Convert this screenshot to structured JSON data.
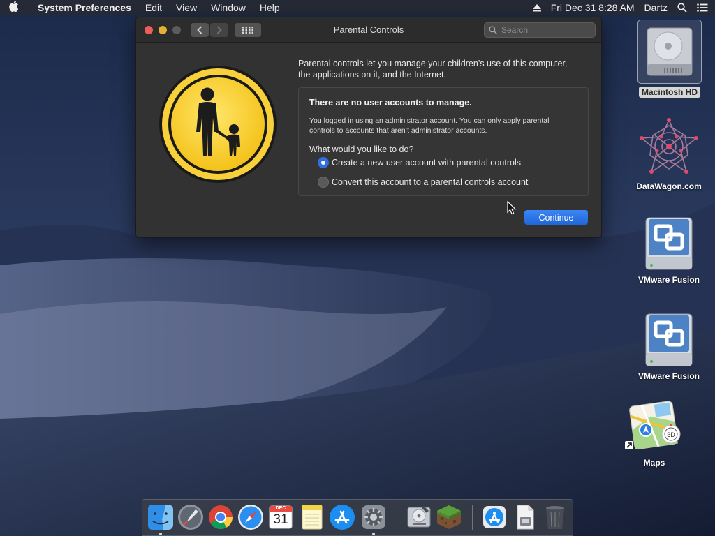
{
  "menubar": {
    "app_name": "System Preferences",
    "menus": [
      "Edit",
      "View",
      "Window",
      "Help"
    ],
    "clock": "Fri Dec 31  8:28 AM",
    "user": "Dartz"
  },
  "window": {
    "title": "Parental Controls",
    "search_placeholder": "Search",
    "intro": "Parental controls let you manage your children’s use of this computer, the applications on it, and the Internet.",
    "panel": {
      "heading": "There are no user accounts to manage.",
      "note": "You logged in using an administrator account. You can only apply parental controls to accounts that aren’t administrator accounts.",
      "question": "What would you like to do?",
      "options": [
        {
          "label": "Create a new user account with parental controls",
          "selected": true
        },
        {
          "label": "Convert this account to a parental controls account",
          "selected": false
        }
      ]
    },
    "continue_label": "Continue"
  },
  "desktop": {
    "icons": [
      {
        "label": "Macintosh HD",
        "icon": "hard-drive-icon",
        "selected": true
      },
      {
        "label": "DataWagon.com",
        "icon": "datawagon-icon"
      },
      {
        "label": "VMware Fusion",
        "icon": "vmware-fusion-icon"
      },
      {
        "label": "VMware Fusion",
        "icon": "vmware-fusion-icon"
      },
      {
        "label": "Maps",
        "icon": "maps-icon",
        "alias": true
      }
    ]
  },
  "dock": {
    "calendar_month": "DEC",
    "calendar_day": "31",
    "items": [
      "finder-icon",
      "launchpad-icon",
      "chrome-icon",
      "safari-icon",
      "calendar-icon",
      "notes-icon",
      "app-store-icon",
      "system-preferences-icon",
      "disk-utility-icon",
      "minecraft-icon",
      "app-store-downloads-icon",
      "document-icon",
      "trash-icon"
    ]
  }
}
